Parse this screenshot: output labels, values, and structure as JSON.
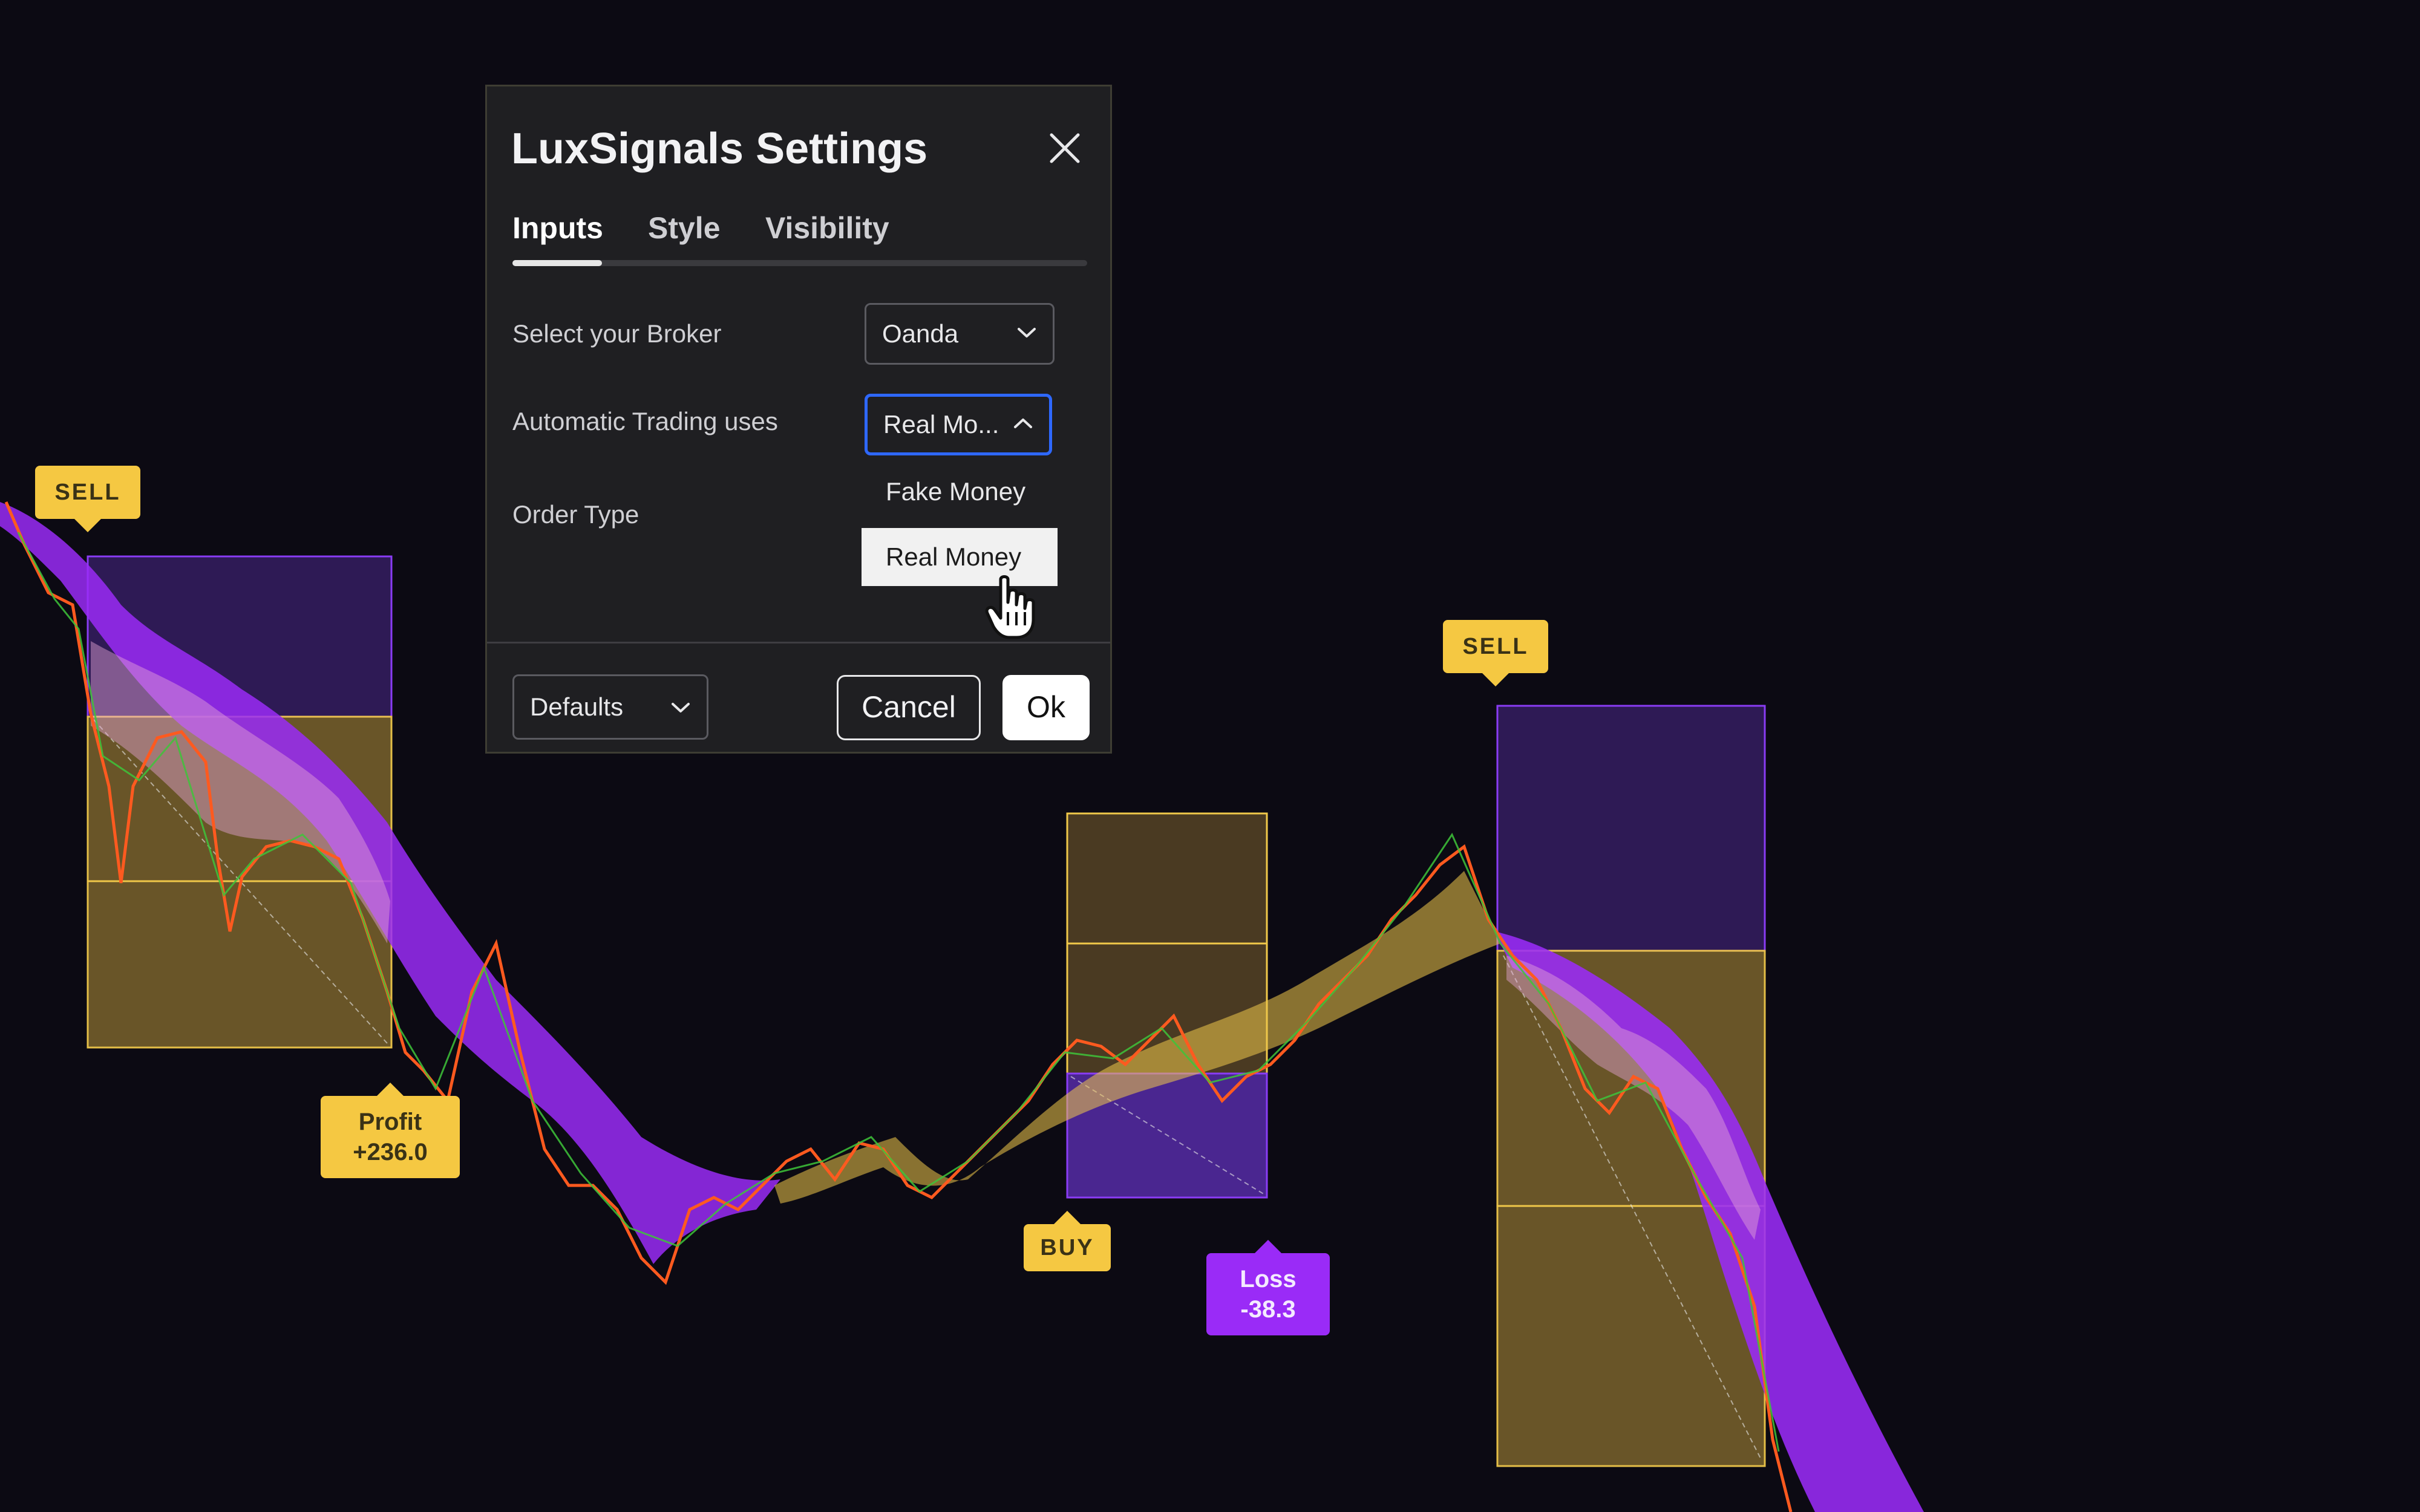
{
  "dialog": {
    "title": "LuxSignals Settings",
    "tabs": [
      {
        "label": "Inputs",
        "active": true
      },
      {
        "label": "Style",
        "active": false
      },
      {
        "label": "Visibility",
        "active": false
      }
    ],
    "fields": {
      "broker": {
        "label": "Select your Broker",
        "value": "Oanda"
      },
      "auto_trading": {
        "label": "Automatic Trading uses",
        "value": "Real Mo...",
        "options": [
          "Fake Money",
          "Real Money"
        ],
        "selected_option": "Real Money",
        "open": true
      },
      "order_type": {
        "label": "Order Type"
      }
    },
    "footer": {
      "defaults_label": "Defaults",
      "cancel_label": "Cancel",
      "ok_label": "Ok"
    }
  },
  "chart": {
    "signals": [
      {
        "kind": "sell",
        "label": "SELL"
      },
      {
        "kind": "buy",
        "label": "BUY"
      },
      {
        "kind": "sell",
        "label": "SELL"
      }
    ],
    "results": [
      {
        "kind": "profit",
        "line1": "Profit",
        "line2": "+236.0"
      },
      {
        "kind": "loss",
        "line1": "Loss",
        "line2": "-38.3"
      }
    ]
  },
  "colors": {
    "background": "#0c0a13",
    "candle_up": "#3ec43a",
    "candle_down": "#ff5a1f",
    "band_bear": "#9a2bf7",
    "band_bull": "#f5c842",
    "label_yellow": "#f5c842",
    "label_purple": "#9a2bf7",
    "focus_blue": "#2e68ff"
  },
  "icons": {
    "close": "close-icon",
    "chevron": "chevron-down-icon",
    "cursor": "hand-cursor-icon"
  }
}
